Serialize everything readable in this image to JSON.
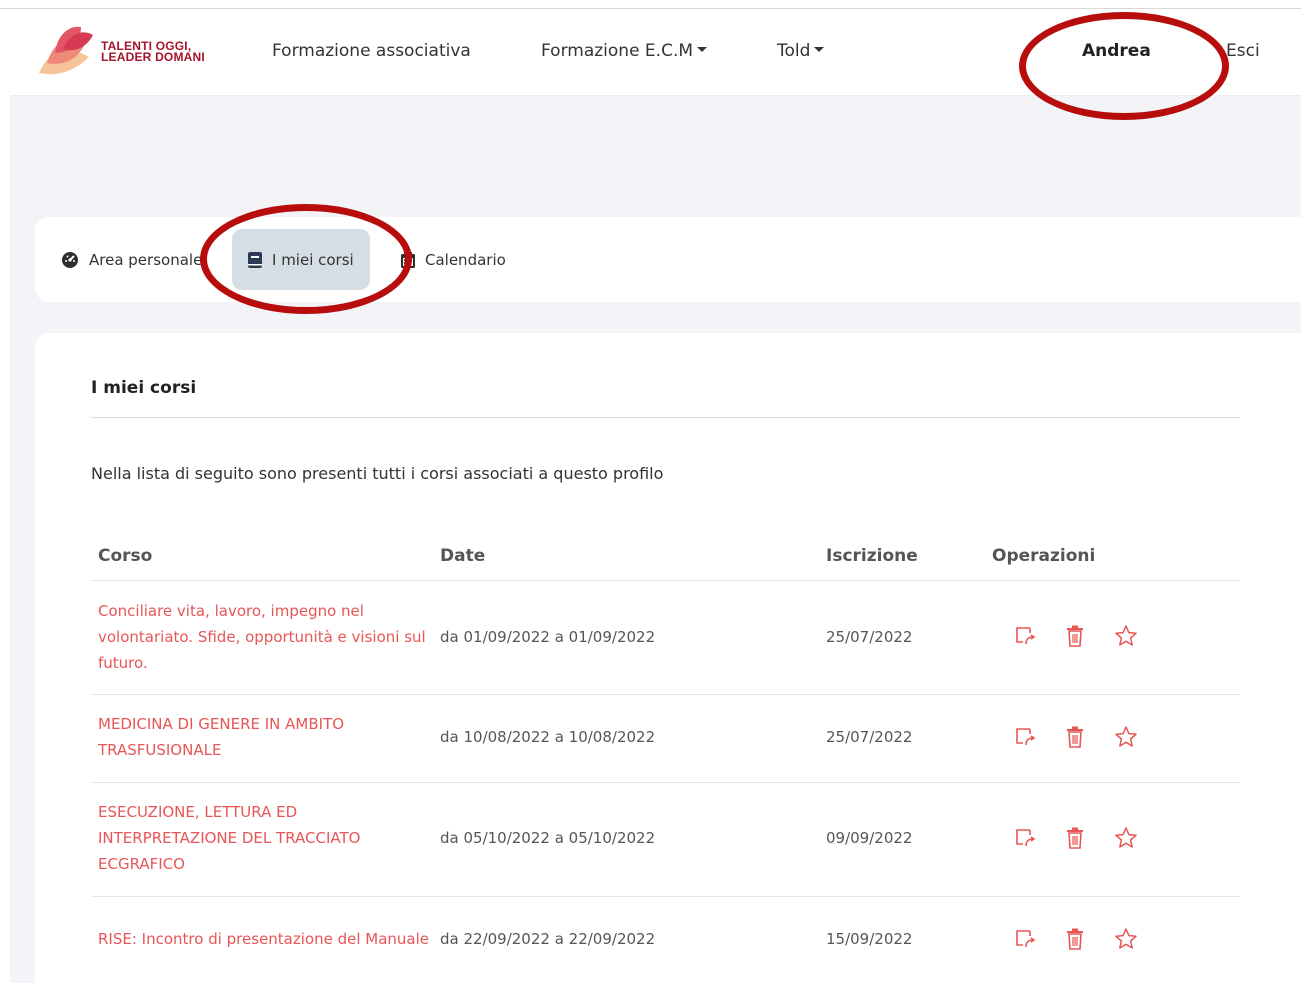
{
  "header": {
    "logo_line1": "TALENTI OGGI,",
    "logo_line2": "LEADER DOMANI",
    "nav": [
      "Formazione associativa",
      "Formazione E.C.M",
      "Told"
    ],
    "user_name": "Andrea",
    "logout_label": "Esci"
  },
  "tabs": [
    {
      "label": "Area personale",
      "icon": "dashboard-icon"
    },
    {
      "label": "I miei corsi",
      "icon": "book-icon",
      "active": true
    },
    {
      "label": "Calendario",
      "icon": "calendar-icon"
    }
  ],
  "main": {
    "title": "I miei corsi",
    "intro": "Nella lista di seguito sono presenti tutti i corsi associati a questo profilo",
    "columns": [
      "Corso",
      "Date",
      "Iscrizione",
      "Operazioni"
    ],
    "rows": [
      {
        "course": "Conciliare vita, lavoro, impegno nel volontariato. Sfide, opportunità e visioni sul futuro.",
        "dates": "da 01/09/2022 a 01/09/2022",
        "enrolled": "25/07/2022"
      },
      {
        "course": "MEDICINA DI GENERE IN AMBITO TRASFUSIONALE",
        "dates": "da 10/08/2022 a 10/08/2022",
        "enrolled": "25/07/2022"
      },
      {
        "course": "ESECUZIONE, LETTURA ED INTERPRETAZIONE DEL TRACCIATO ECGRAFICO",
        "dates": "da 05/10/2022 a 05/10/2022",
        "enrolled": "09/09/2022"
      },
      {
        "course": "RISE: Incontro di presentazione del Manuale",
        "dates": "da 22/09/2022 a 22/09/2022",
        "enrolled": "15/09/2022"
      }
    ],
    "operations": [
      "open-course-icon",
      "trash-icon",
      "star-icon"
    ]
  },
  "colors": {
    "brand": "#a4142a",
    "link": "#e75656",
    "annotation": "#b80d0d",
    "active_tab": "#d4dee4",
    "background": "#f3f4f8"
  }
}
